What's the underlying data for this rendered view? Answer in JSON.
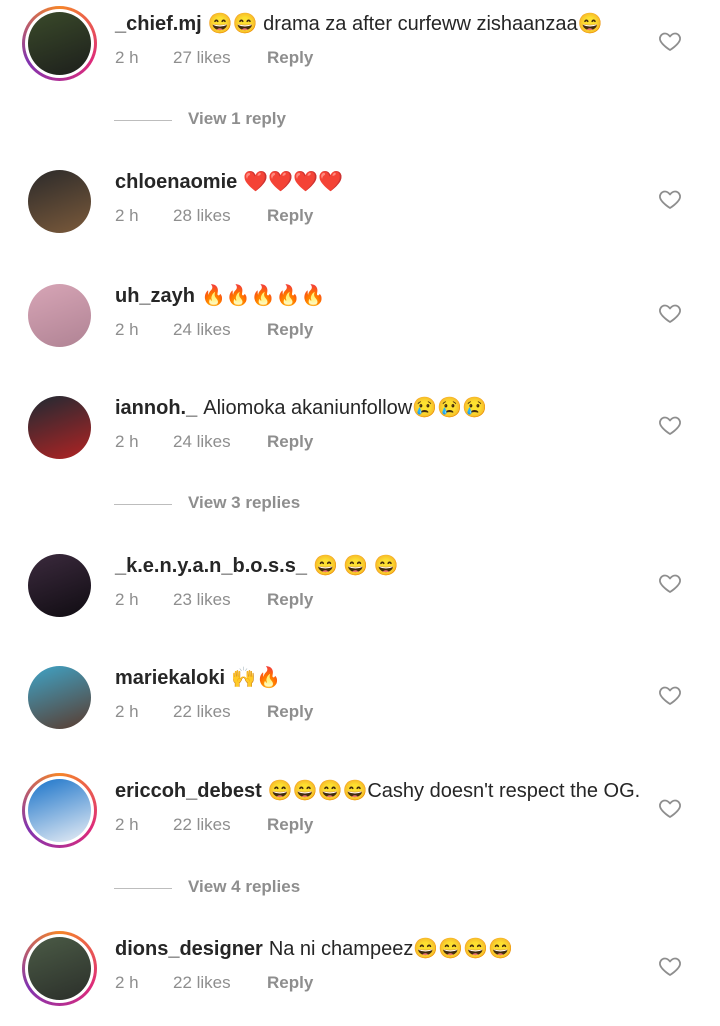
{
  "comments": [
    {
      "username": "_chief.mj",
      "text": "😄😄 drama za after curfeww zishaanzaa😄",
      "time": "2 h",
      "likes": "27 likes",
      "reply": "Reply",
      "story": true,
      "avatar_colors": [
        "#3a4a2a",
        "#1d1f1c"
      ]
    },
    {
      "username": "chloenaomie",
      "text": "❤️❤️❤️❤️",
      "time": "2 h",
      "likes": "28 likes",
      "reply": "Reply",
      "story": false,
      "avatar_colors": [
        "#2b2a2a",
        "#7b5a3b"
      ]
    },
    {
      "username": "uh_zayh",
      "text": "🔥🔥🔥🔥🔥",
      "time": "2 h",
      "likes": "24 likes",
      "reply": "Reply",
      "story": false,
      "avatar_colors": [
        "#d7a5b6",
        "#b08394"
      ]
    },
    {
      "username": "iannoh._",
      "text": "Aliomoka akaniunfollow😢😢😢",
      "time": "2 h",
      "likes": "24 likes",
      "reply": "Reply",
      "story": false,
      "avatar_colors": [
        "#1e2a33",
        "#b22323"
      ]
    },
    {
      "username": "_k.e.n.y.a.n_b.o.s.s_",
      "text": "😄 😄 😄",
      "time": "2 h",
      "likes": "23 likes",
      "reply": "Reply",
      "story": false,
      "avatar_colors": [
        "#3b2a3d",
        "#100c12"
      ]
    },
    {
      "username": "mariekaloki",
      "text": "🙌🔥",
      "time": "2 h",
      "likes": "22 likes",
      "reply": "Reply",
      "story": false,
      "avatar_colors": [
        "#3fa4c7",
        "#5a3b2e"
      ]
    },
    {
      "username": "ericcoh_debest",
      "text": "😄😄😄😄Cashy doesn't respect the OG.",
      "time": "2 h",
      "likes": "22 likes",
      "reply": "Reply",
      "story": true,
      "avatar_colors": [
        "#1a73c9",
        "#e9eef5"
      ]
    },
    {
      "username": "dions_designer",
      "text": "Na ni champeez😄😄😄😄",
      "time": "2 h",
      "likes": "22 likes",
      "reply": "Reply",
      "story": true,
      "avatar_colors": [
        "#4b5b46",
        "#2b2f2a"
      ]
    }
  ],
  "view_replies": [
    "View 1 reply",
    "View 3 replies",
    "View 4 replies"
  ],
  "colors": {
    "text": "#262626",
    "muted": "#8e8e8e",
    "background": "#ffffff"
  }
}
